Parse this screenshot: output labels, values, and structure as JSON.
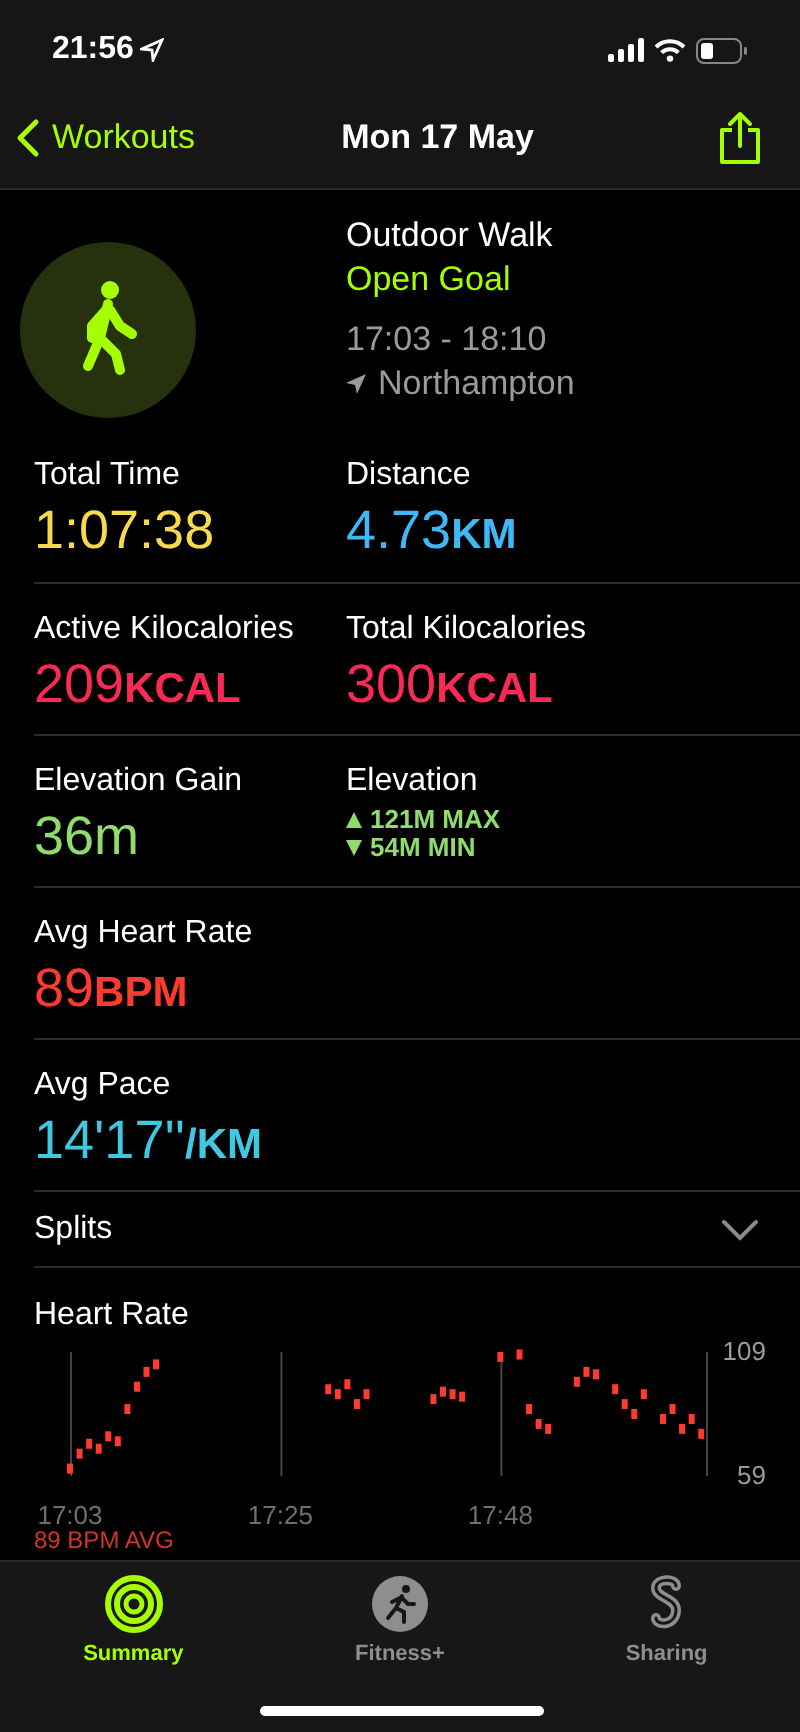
{
  "status_bar": {
    "time": "21:56"
  },
  "nav": {
    "back": "Workouts",
    "title": "Mon 17 May"
  },
  "workout": {
    "type": "Outdoor Walk",
    "goal": "Open Goal",
    "time_range": "17:03 - 18:10",
    "location": "Northampton"
  },
  "metrics": [
    [
      {
        "kind": "metric",
        "label": "Total Time",
        "value": "1:07:38",
        "color": "#f7d94c"
      },
      {
        "kind": "metric",
        "label": "Distance",
        "value": "4.73",
        "unit": "KM",
        "color": "#3fb8f5"
      }
    ],
    [
      {
        "kind": "metric",
        "label": "Active Kilocalories",
        "value": "209",
        "unit": "KCAL",
        "color": "#fa2a55"
      },
      {
        "kind": "metric",
        "label": "Total Kilocalories",
        "value": "300",
        "unit": "KCAL",
        "color": "#fa2a55"
      }
    ],
    [
      {
        "kind": "metric",
        "label": "Elevation Gain",
        "value": "36m",
        "color": "#8fdb6b"
      },
      {
        "kind": "range",
        "label": "Elevation",
        "max": "121M MAX",
        "min": "54M MIN",
        "color": "#8fdb6b"
      }
    ],
    [
      {
        "kind": "metric",
        "label": "Avg Heart Rate",
        "value": "89",
        "unit": "BPM",
        "color": "#ff3b30"
      }
    ],
    [
      {
        "kind": "metric",
        "label": "Avg Pace",
        "value": "14'17''",
        "unit": "/KM",
        "color": "#40c8e0"
      }
    ]
  ],
  "splits": {
    "label": "Splits",
    "expanded": false
  },
  "heart_rate": {
    "title": "Heart Rate",
    "average": "89 BPM AVG",
    "chart_data": {
      "type": "scatter",
      "ylim": [
        59,
        109
      ],
      "yticks": [
        59,
        109
      ],
      "categories": [
        "17:03",
        null,
        null,
        null,
        null,
        null,
        null,
        null,
        null,
        null,
        null,
        null,
        null,
        null,
        null,
        null,
        null,
        null,
        null,
        null,
        null,
        null,
        "17:25",
        null,
        null,
        null,
        null,
        null,
        null,
        null,
        null,
        null,
        null,
        null,
        null,
        null,
        null,
        null,
        null,
        null,
        null,
        null,
        null,
        null,
        null,
        "17:48",
        null,
        null,
        null,
        null,
        null,
        null,
        null,
        null,
        null,
        null,
        null,
        null,
        null,
        null,
        null,
        null,
        null,
        null,
        null,
        null,
        null
      ],
      "series": [
        {
          "color": "#ff3b30",
          "values": [
            62,
            68,
            72,
            70,
            75,
            73,
            86,
            95,
            101,
            104,
            null,
            null,
            null,
            null,
            null,
            null,
            null,
            null,
            null,
            null,
            null,
            null,
            null,
            null,
            null,
            null,
            null,
            94,
            92,
            96,
            88,
            92,
            null,
            null,
            null,
            null,
            null,
            null,
            90,
            93,
            92,
            91,
            null,
            null,
            null,
            107,
            null,
            108,
            86,
            80,
            78,
            null,
            null,
            97,
            101,
            100,
            null,
            94,
            88,
            84,
            92,
            null,
            82,
            86,
            78,
            82,
            76
          ]
        }
      ]
    }
  },
  "tab_bar": [
    {
      "label": "Summary",
      "selected": true
    },
    {
      "label": "Fitness+",
      "selected": false
    },
    {
      "label": "Sharing",
      "selected": false
    }
  ]
}
